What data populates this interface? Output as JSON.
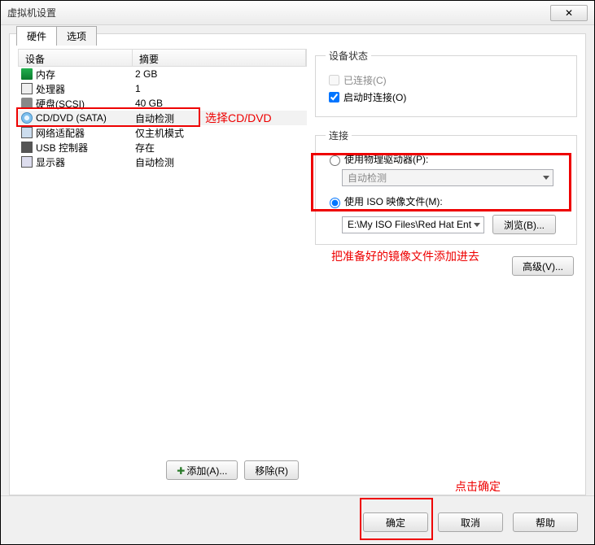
{
  "window": {
    "title": "虚拟机设置",
    "close_glyph": "✕"
  },
  "tabs": {
    "hardware": "硬件",
    "options": "选项"
  },
  "headers": {
    "device": "设备",
    "summary": "摘要"
  },
  "rows": {
    "mem": {
      "label": "内存",
      "summary": "2 GB"
    },
    "cpu": {
      "label": "处理器",
      "summary": "1"
    },
    "hdd": {
      "label": "硬盘(SCSI)",
      "summary": "40 GB"
    },
    "cd": {
      "label": "CD/DVD (SATA)",
      "summary": "自动检测"
    },
    "net": {
      "label": "网络适配器",
      "summary": "仅主机模式"
    },
    "usb": {
      "label": "USB 控制器",
      "summary": "存在"
    },
    "disp": {
      "label": "显示器",
      "summary": "自动检测"
    }
  },
  "left_buttons": {
    "add": "添加(A)...",
    "remove": "移除(R)"
  },
  "status_group": {
    "legend": "设备状态",
    "connected": "已连接(C)",
    "connect_on_power": "启动时连接(O)"
  },
  "connect_group": {
    "legend": "连接",
    "use_physical": "使用物理驱动器(P):",
    "physical_value": "自动检测",
    "use_iso": "使用 ISO 映像文件(M):",
    "iso_value": "E:\\My ISO Files\\Red Hat Ent",
    "browse": "浏览(B)..."
  },
  "advanced": "高级(V)...",
  "annotations": {
    "select_cd": "选择CD/DVD",
    "add_image": "把准备好的镜像文件添加进去",
    "click_ok": "点击确定"
  },
  "bottom": {
    "ok": "确定",
    "cancel": "取消",
    "help": "帮助"
  }
}
